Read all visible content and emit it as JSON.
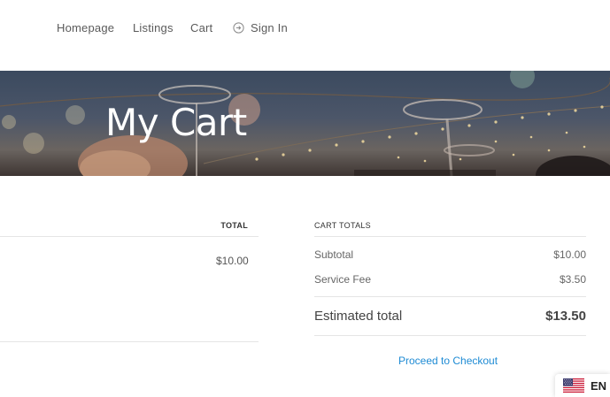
{
  "nav": {
    "items": [
      {
        "label": "Homepage"
      },
      {
        "label": "Listings"
      },
      {
        "label": "Cart"
      }
    ],
    "sign_in_label": "Sign In",
    "sign_in_icon": "sign-in-icon"
  },
  "hero": {
    "title": "My Cart"
  },
  "cart_table": {
    "total_header": "TOTAL",
    "rows": [
      {
        "total": "$10.00"
      }
    ]
  },
  "cart_totals": {
    "title": "CART TOTALS",
    "subtotal_label": "Subtotal",
    "subtotal_value": "$10.00",
    "service_fee_label": "Service Fee",
    "service_fee_value": "$3.50",
    "estimated_total_label": "Estimated total",
    "estimated_total_value": "$13.50",
    "checkout_label": "Proceed to Checkout"
  },
  "language": {
    "code": "EN",
    "flag_icon": "us-flag-icon"
  },
  "colors": {
    "link": "#1e8bd4",
    "nav_text": "#5a5a5a",
    "hero_text": "#ffffff"
  }
}
